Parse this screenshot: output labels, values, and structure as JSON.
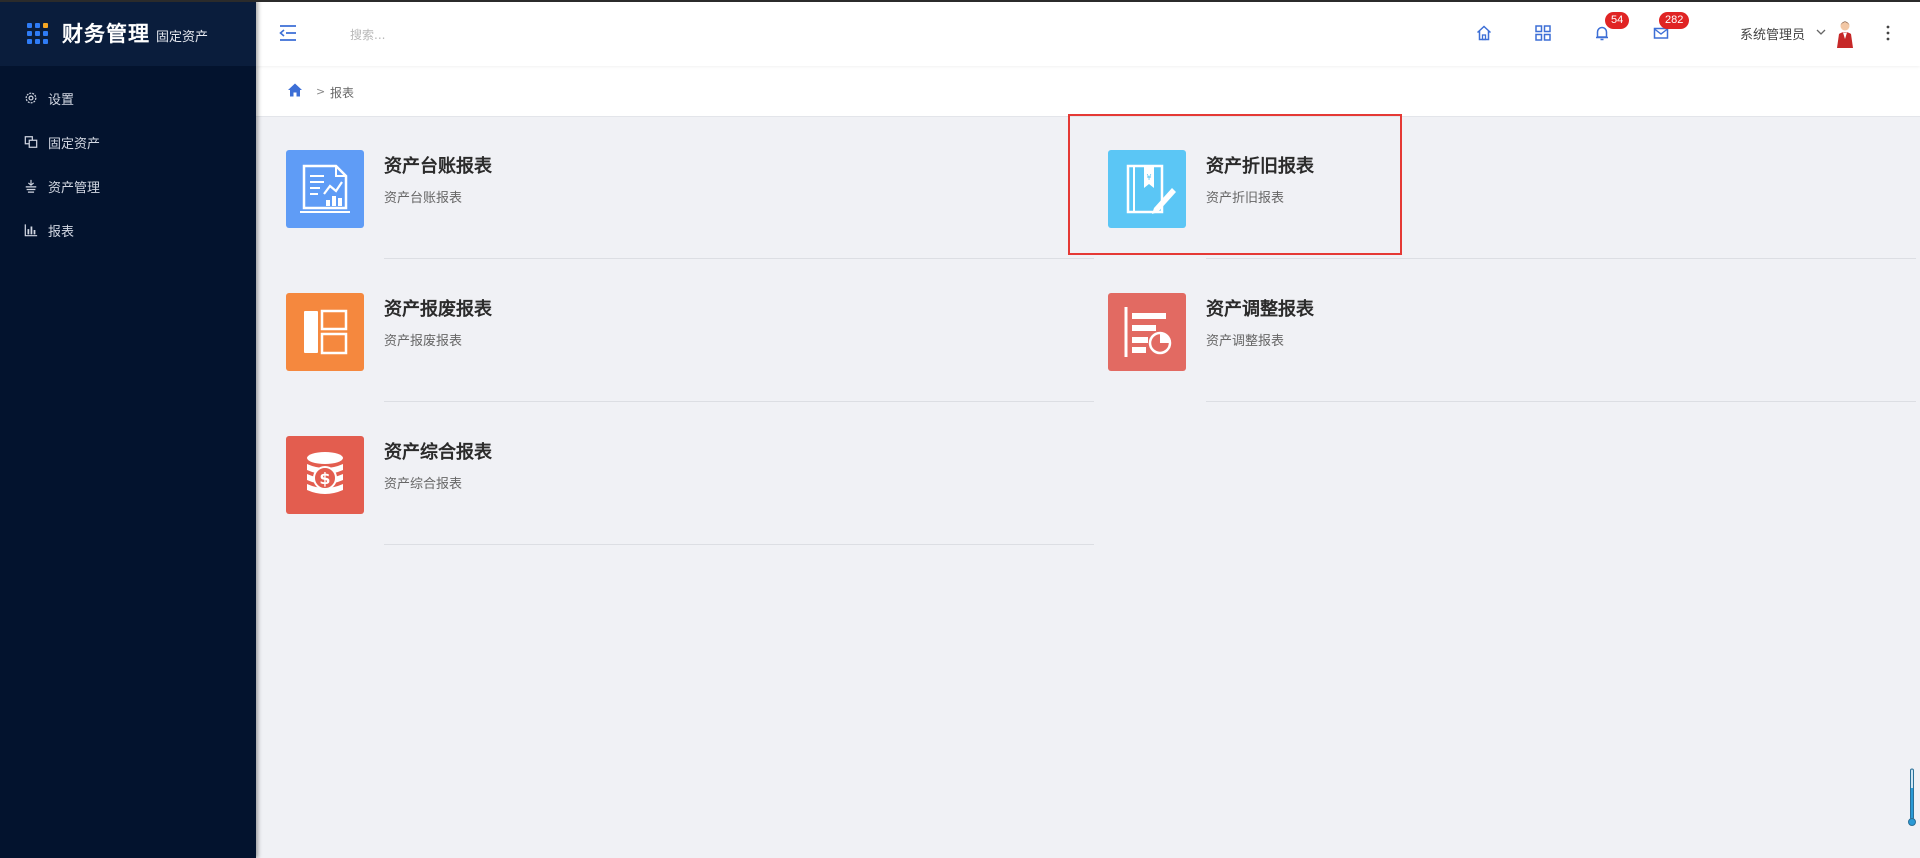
{
  "app": {
    "title": "财务管理",
    "subtitle": "固定资产",
    "logo_icon": "grid-dots-icon"
  },
  "sidebar": {
    "items": [
      {
        "label": "设置",
        "icon": "gear-icon"
      },
      {
        "label": "固定资产",
        "icon": "assets-icon"
      },
      {
        "label": "资产管理",
        "icon": "stack-icon"
      },
      {
        "label": "报表",
        "icon": "bar-chart-icon"
      }
    ]
  },
  "header": {
    "search_placeholder": "搜索...",
    "notifications_count": "54",
    "messages_count": "282",
    "user_name": "系统管理员"
  },
  "breadcrumb": {
    "separator": ">",
    "current": "报表"
  },
  "reports": [
    {
      "title": "资产台账报表",
      "desc": "资产台账报表",
      "color": "#5f9cf6",
      "icon": "ledger-chart-icon"
    },
    {
      "title": "资产折旧报表",
      "desc": "资产折旧报表",
      "color": "#5bc6f5",
      "icon": "book-pen-icon"
    },
    {
      "title": "资产报废报表",
      "desc": "资产报废报表",
      "color": "#f5883e",
      "icon": "layout-panels-icon"
    },
    {
      "title": "资产调整报表",
      "desc": "资产调整报表",
      "color": "#e26a62",
      "icon": "list-pie-icon"
    },
    {
      "title": "资产综合报表",
      "desc": "资产综合报表",
      "color": "#e35d4f",
      "icon": "coin-stack-icon"
    }
  ],
  "colors": {
    "sidebar_bg": "#03132e",
    "brand_bg": "#0a1d3c",
    "accent": "#3d6fd6",
    "badge": "#e02424",
    "highlight": "#e53935"
  }
}
